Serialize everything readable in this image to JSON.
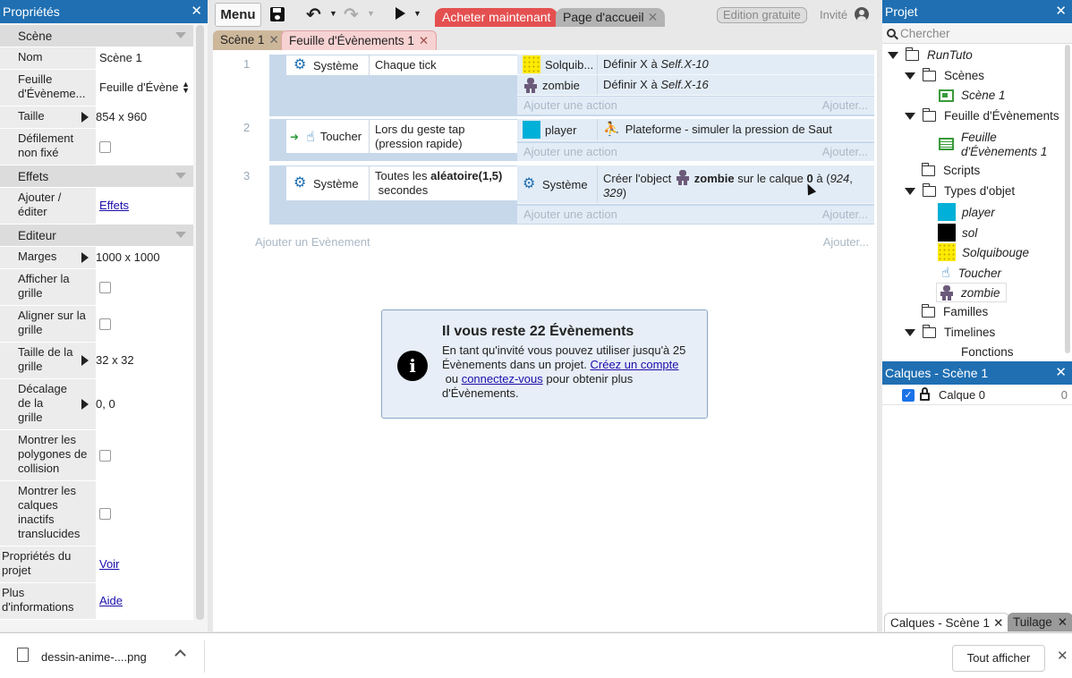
{
  "properties": {
    "title": "Propriétés",
    "close": "✕",
    "sections": {
      "scene": "Scène",
      "effects": "Effets",
      "editor": "Editeur"
    },
    "rows": {
      "name_label": "Nom",
      "name_value": "Scène 1",
      "sheet_label": "Feuille d'Évèneme...",
      "sheet_value": "Feuille d'Évène",
      "size_label": "Taille",
      "size_value": "854 x 960",
      "scroll_label": "Défilement non fixé",
      "add_effects_label": "Ajouter / éditer",
      "add_effects_value": "Effets",
      "margins_label": "Marges",
      "margins_value": "1000 x 1000",
      "show_grid_label": "Afficher la grille",
      "snap_grid_label": "Aligner sur la grille",
      "grid_size_label": "Taille de la grille",
      "grid_size_value": "32 x 32",
      "grid_offset_label": "Décalage de la grille",
      "grid_offset_value": "0, 0",
      "collision_label": "Montrer les polygones de collision",
      "inactive_layers_label": "Montrer les calques inactifs translucides",
      "project_props_label": "Propriétés du projet",
      "project_props_value": "Voir",
      "more_info_label": "Plus d'informations",
      "more_info_value": "Aide"
    }
  },
  "toolbar": {
    "menu": "Menu",
    "buy": "Acheter maintenant",
    "home": "Page d'accueil",
    "free_edition": "Edition gratuite",
    "guest": "Invité"
  },
  "tabs": [
    {
      "label": "Scène 1"
    },
    {
      "label": "Feuille d'Évènements 1"
    }
  ],
  "events": [
    {
      "number": "1",
      "condition": {
        "object": "Système",
        "text": "Chaque tick"
      },
      "actions": [
        {
          "object": "Solquib...",
          "text_prefix": "Définir X à ",
          "text_italic": "Self.X-10"
        },
        {
          "object": "zombie",
          "text_prefix": "Définir X à ",
          "text_italic": "Self.X-16"
        }
      ],
      "add_action": "Ajouter une action",
      "add_more": "Ajouter..."
    },
    {
      "number": "2",
      "condition": {
        "object": "Toucher",
        "text": "Lors du geste tap (pression rapide)"
      },
      "actions": [
        {
          "object": "player",
          "text_prefix": "Plateforme - simuler la pression de Saut"
        }
      ],
      "add_action": "Ajouter une action",
      "add_more": "Ajouter..."
    },
    {
      "number": "3",
      "condition": {
        "object": "Système",
        "text_prefix": "Toutes les ",
        "text_bold": "aléatoire(1,5)",
        "text_suffix": " secondes"
      },
      "actions": [
        {
          "object": "Système",
          "p1": "Créer l'object ",
          "p2": "zombie",
          "p3": " sur le calque ",
          "p4": "0",
          "p5": " à (",
          "p6": "924",
          "p7": ", ",
          "p8": "329",
          "p9": ")"
        }
      ],
      "add_action": "Ajouter une action",
      "add_more": "Ajouter..."
    }
  ],
  "add_event": "Ajouter un Evènement",
  "add_event_more": "Ajouter...",
  "info_box": {
    "icon": "i",
    "title": "Il vous reste 22 Évènements",
    "msg_1": "En tant qu'invité vous pouvez utiliser jusqu'à 25 Évènements dans un projet. ",
    "link_1": "Créez un compte",
    "msg_2": " ou ",
    "link_2": "connectez-vous",
    "msg_3": " pour obtenir plus d'Évènements."
  },
  "project": {
    "title": "Projet",
    "search_placeholder": "Chercher",
    "tree": {
      "root": "RunTuto",
      "scenes": "Scènes",
      "scene1": "Scène 1",
      "sheets": "Feuille d'Évènements",
      "sheet1": "Feuille d'Évènements 1",
      "scripts": "Scripts",
      "object_types": "Types d'objet",
      "obj_player": "player",
      "obj_sol": "sol",
      "obj_solquibouge": "Solquibouge",
      "obj_toucher": "Toucher",
      "obj_zombie": "zombie",
      "families": "Familles",
      "timelines": "Timelines",
      "functions": "Fonctions"
    }
  },
  "layers": {
    "title": "Calques - Scène 1",
    "layer_name": "Calque 0",
    "layer_index": "0"
  },
  "bottom_tabs": {
    "layers": "Calques - Scène 1",
    "tiling": "Tuilage"
  },
  "download_bar": {
    "file": "dessin-anime-....png",
    "show_all": "Tout afficher"
  },
  "colors": {
    "accent": "#1f6fb2",
    "buy": "#e45050",
    "event_bg": "#c7d8ea",
    "action_bg": "#e2ecf6"
  }
}
